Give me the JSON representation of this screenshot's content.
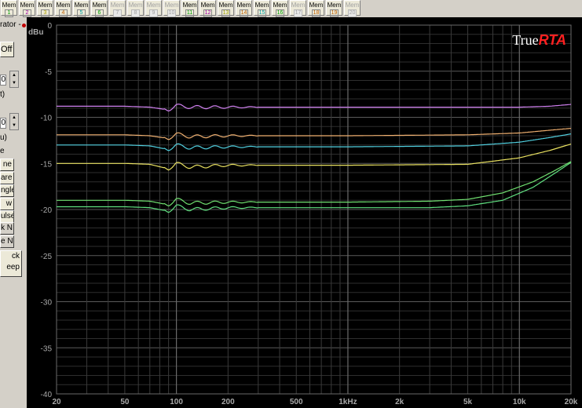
{
  "toolbar": {
    "mem_buttons": [
      {
        "label": "Mem",
        "num": "1",
        "color": "#00a000",
        "active": true
      },
      {
        "label": "Mem",
        "num": "2",
        "color": "#a000a0",
        "active": true
      },
      {
        "label": "Mem",
        "num": "3",
        "color": "#b0a000",
        "active": true
      },
      {
        "label": "Mem",
        "num": "4",
        "color": "#c06000",
        "active": true
      },
      {
        "label": "Mem",
        "num": "5",
        "color": "#00a0a0",
        "active": true
      },
      {
        "label": "Mem",
        "num": "6",
        "color": "#00a000",
        "active": true
      },
      {
        "label": "Mem",
        "num": "7",
        "color": "#a0a0a0",
        "active": false
      },
      {
        "label": "Mem",
        "num": "8",
        "color": "#a0a0a0",
        "active": false
      },
      {
        "label": "Mem",
        "num": "9",
        "color": "#a0a0a0",
        "active": false
      },
      {
        "label": "Mem",
        "num": "10",
        "color": "#a0a0a0",
        "active": false
      },
      {
        "label": "Mem",
        "num": "11",
        "color": "#00a000",
        "active": true
      },
      {
        "label": "Mem",
        "num": "12",
        "color": "#a000a0",
        "active": true
      },
      {
        "label": "Mem",
        "num": "13",
        "color": "#a0a000",
        "active": true
      },
      {
        "label": "Mem",
        "num": "14",
        "color": "#c06000",
        "active": true
      },
      {
        "label": "Mem",
        "num": "15",
        "color": "#00a0a0",
        "active": true
      },
      {
        "label": "Mem",
        "num": "16",
        "color": "#00a000",
        "active": true
      },
      {
        "label": "Mem",
        "num": "17",
        "color": "#a0a0a0",
        "active": false
      },
      {
        "label": "Mem",
        "num": "18",
        "color": "#c06000",
        "active": true
      },
      {
        "label": "Mem",
        "num": "19",
        "color": "#c06000",
        "active": true
      },
      {
        "label": "Mem",
        "num": "20",
        "color": "#a0a0a0",
        "active": false
      }
    ]
  },
  "left_panel": {
    "generator_label": "rator -",
    "off_button": "Off",
    "field1_unit": "t)",
    "field2_unit": "u)",
    "section_label": "e",
    "waveform_buttons": [
      "ne",
      "are",
      "ngle",
      "w",
      "ulse"
    ],
    "noise_labels": [
      "k N",
      "e N"
    ],
    "bottom_buttons": [
      "ck",
      "eep"
    ],
    "spin_value1": "0",
    "spin_value2": "0"
  },
  "chart_data": {
    "type": "line",
    "brand": {
      "text_plain": "True",
      "text_accent": "RTA",
      "accent_color": "#ff2020"
    },
    "ylabel": "dBu",
    "ylim": [
      -40,
      0
    ],
    "y_ticks": [
      "0",
      "-5",
      "-10",
      "-15",
      "-20",
      "-25",
      "-30",
      "-35",
      "-40"
    ],
    "x_scale": "log",
    "xlim": [
      20,
      20000
    ],
    "x_ticks": [
      {
        "value": 20,
        "label": "20"
      },
      {
        "value": 50,
        "label": "50"
      },
      {
        "value": 100,
        "label": "100"
      },
      {
        "value": 200,
        "label": "200"
      },
      {
        "value": 500,
        "label": "500"
      },
      {
        "value": 1000,
        "label": "1kHz"
      },
      {
        "value": 2000,
        "label": "2k"
      },
      {
        "value": 5000,
        "label": "5k"
      },
      {
        "value": 10000,
        "label": "10k"
      },
      {
        "value": 20000,
        "label": "20k"
      }
    ],
    "grid": true,
    "series": [
      {
        "color": "#d080f0",
        "points": [
          [
            20,
            -8.8
          ],
          [
            50,
            -8.8
          ],
          [
            70,
            -8.9
          ],
          [
            90,
            -9.2
          ],
          [
            100,
            -8.7
          ],
          [
            120,
            -8.9
          ],
          [
            200,
            -8.9
          ],
          [
            1000,
            -8.9
          ],
          [
            5000,
            -8.9
          ],
          [
            10000,
            -8.9
          ],
          [
            15000,
            -8.8
          ],
          [
            20000,
            -8.6
          ]
        ]
      },
      {
        "color": "#f0b070",
        "points": [
          [
            20,
            -11.9
          ],
          [
            50,
            -11.9
          ],
          [
            70,
            -12.0
          ],
          [
            90,
            -12.3
          ],
          [
            100,
            -11.8
          ],
          [
            120,
            -12.1
          ],
          [
            200,
            -12.0
          ],
          [
            1000,
            -12.0
          ],
          [
            5000,
            -11.9
          ],
          [
            10000,
            -11.7
          ],
          [
            15000,
            -11.4
          ],
          [
            20000,
            -11.2
          ]
        ]
      },
      {
        "color": "#50d0e0",
        "points": [
          [
            20,
            -13.0
          ],
          [
            50,
            -13.0
          ],
          [
            70,
            -13.1
          ],
          [
            90,
            -13.5
          ],
          [
            100,
            -13.0
          ],
          [
            120,
            -13.3
          ],
          [
            200,
            -13.2
          ],
          [
            1000,
            -13.2
          ],
          [
            5000,
            -13.1
          ],
          [
            10000,
            -12.7
          ],
          [
            15000,
            -12.2
          ],
          [
            20000,
            -11.8
          ]
        ]
      },
      {
        "color": "#e8e060",
        "points": [
          [
            20,
            -15.0
          ],
          [
            50,
            -15.0
          ],
          [
            70,
            -15.1
          ],
          [
            90,
            -15.6
          ],
          [
            100,
            -15.0
          ],
          [
            120,
            -15.4
          ],
          [
            200,
            -15.2
          ],
          [
            1000,
            -15.2
          ],
          [
            5000,
            -15.1
          ],
          [
            10000,
            -14.4
          ],
          [
            15000,
            -13.6
          ],
          [
            20000,
            -12.9
          ]
        ]
      },
      {
        "color": "#70e070",
        "points": [
          [
            20,
            -19.0
          ],
          [
            50,
            -19.0
          ],
          [
            70,
            -19.1
          ],
          [
            90,
            -19.5
          ],
          [
            100,
            -18.9
          ],
          [
            120,
            -19.3
          ],
          [
            200,
            -19.2
          ],
          [
            1000,
            -19.2
          ],
          [
            3000,
            -19.1
          ],
          [
            5000,
            -18.9
          ],
          [
            8000,
            -18.2
          ],
          [
            12000,
            -17.0
          ],
          [
            16000,
            -15.8
          ],
          [
            20000,
            -14.8
          ]
        ]
      },
      {
        "color": "#60e080",
        "points": [
          [
            20,
            -19.7
          ],
          [
            50,
            -19.7
          ],
          [
            70,
            -19.8
          ],
          [
            90,
            -20.2
          ],
          [
            100,
            -19.6
          ],
          [
            120,
            -20.0
          ],
          [
            200,
            -19.8
          ],
          [
            1000,
            -19.8
          ],
          [
            3000,
            -19.8
          ],
          [
            5000,
            -19.6
          ],
          [
            8000,
            -19.0
          ],
          [
            12000,
            -17.6
          ],
          [
            16000,
            -16.1
          ],
          [
            20000,
            -14.9
          ]
        ]
      }
    ]
  }
}
